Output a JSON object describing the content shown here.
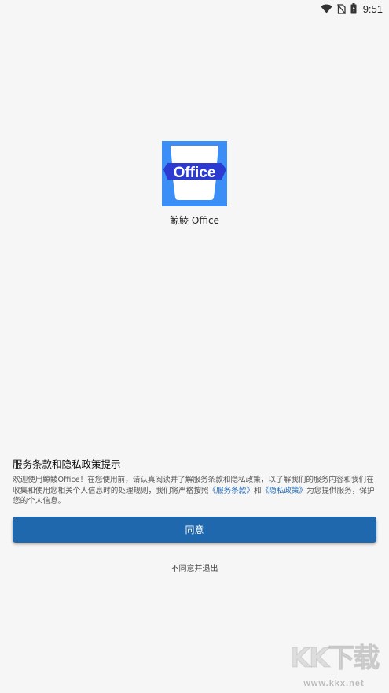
{
  "status_bar": {
    "time": "9:51",
    "icons": [
      "wifi-icon",
      "no-sim-icon",
      "battery-charging-icon"
    ]
  },
  "app": {
    "logo_text": "Office",
    "name": "鲸鲮 Office"
  },
  "consent": {
    "title": "服务条款和隐私政策提示",
    "body_part1": "欢迎使用鲸鲮Office！在您使用前，请认真阅读并了解服务条款和隐私政策，以了解我们的服务内容和我们在收集和使用您相关个人信息时的处理规则，我们将严格按照",
    "terms_link": "《服务条款》",
    "body_and": "和",
    "privacy_link": "《隐私政策》",
    "body_part2": "为您提供服务，保护您的个人信息。",
    "agree_label": "同意",
    "disagree_label": "不同意并退出"
  },
  "watermark": {
    "text": "KK下载",
    "url": "www.kkx.net"
  },
  "colors": {
    "background": "#f6f6f6",
    "primary_button": "#2068ad",
    "link": "#1f66b0",
    "logo_bg": "#3b8ef5",
    "logo_band": "#2b3ad0"
  }
}
